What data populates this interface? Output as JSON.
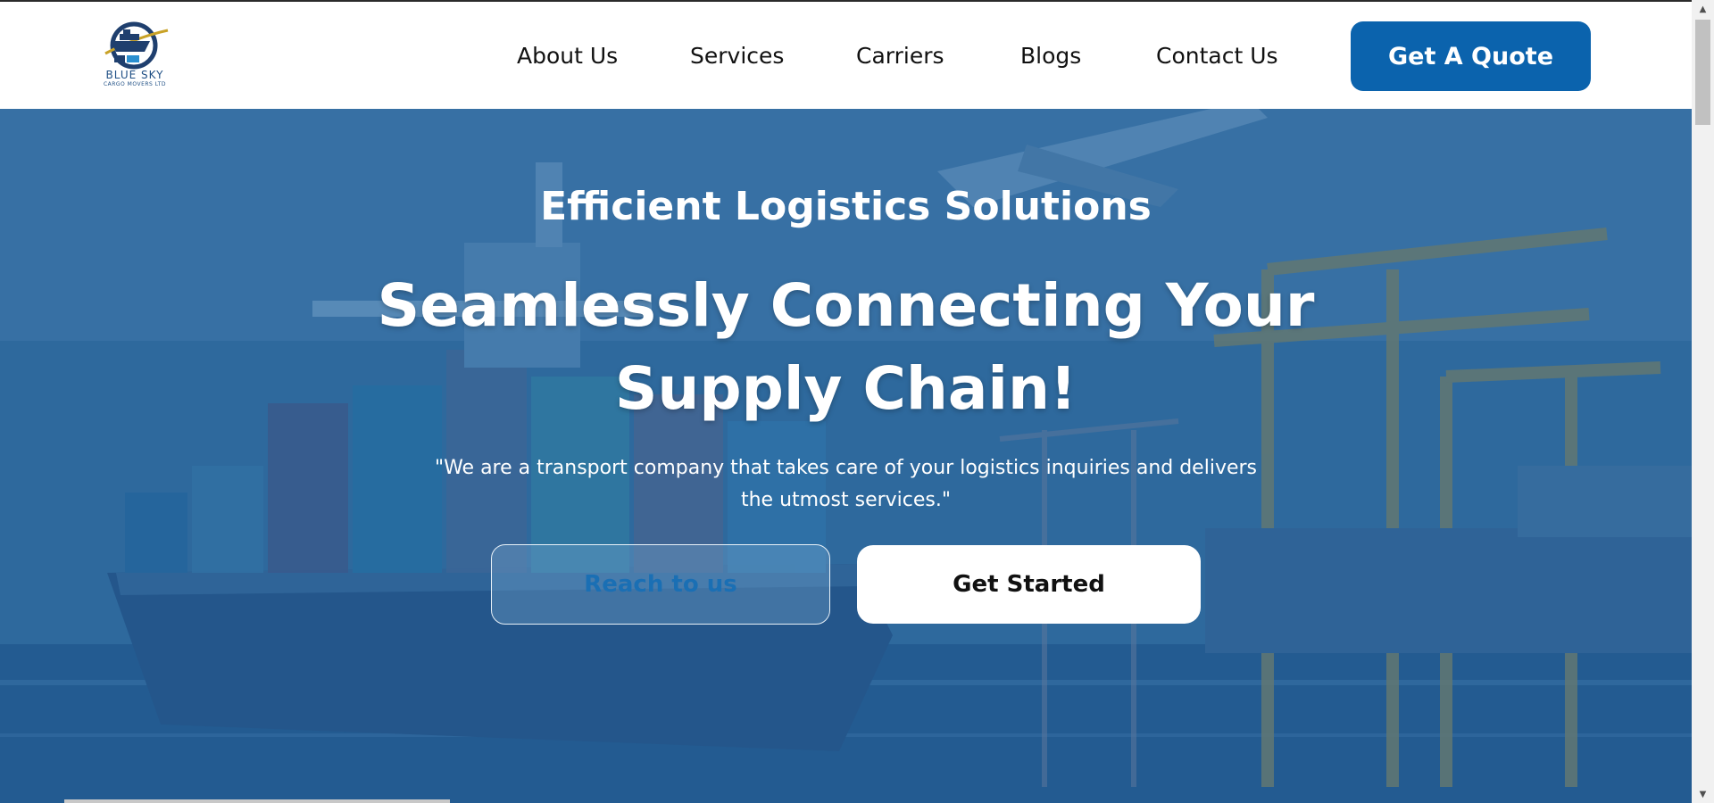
{
  "brand": {
    "name": "BLUE SKY",
    "subtitle": "CARGO MOVERS LTD",
    "logo_icon": "ship-logo-icon",
    "accent_color": "#0b63ad"
  },
  "nav": {
    "items": [
      {
        "label": "About Us"
      },
      {
        "label": "Services"
      },
      {
        "label": "Carriers"
      },
      {
        "label": "Blogs"
      },
      {
        "label": "Contact Us"
      }
    ],
    "cta_label": "Get A Quote"
  },
  "hero": {
    "eyebrow": "Efficient Logistics Solutions",
    "headline_line1": "Seamlessly Connecting Your",
    "headline_line2": "Supply Chain!",
    "tagline": "\"We are a transport company that takes care of your logistics inquiries and delivers the utmost services.\"",
    "reach_label": "Reach to us",
    "start_label": "Get Started"
  },
  "scrollbar": {
    "up_icon": "scroll-up-arrow-icon",
    "down_icon": "scroll-down-arrow-icon"
  }
}
